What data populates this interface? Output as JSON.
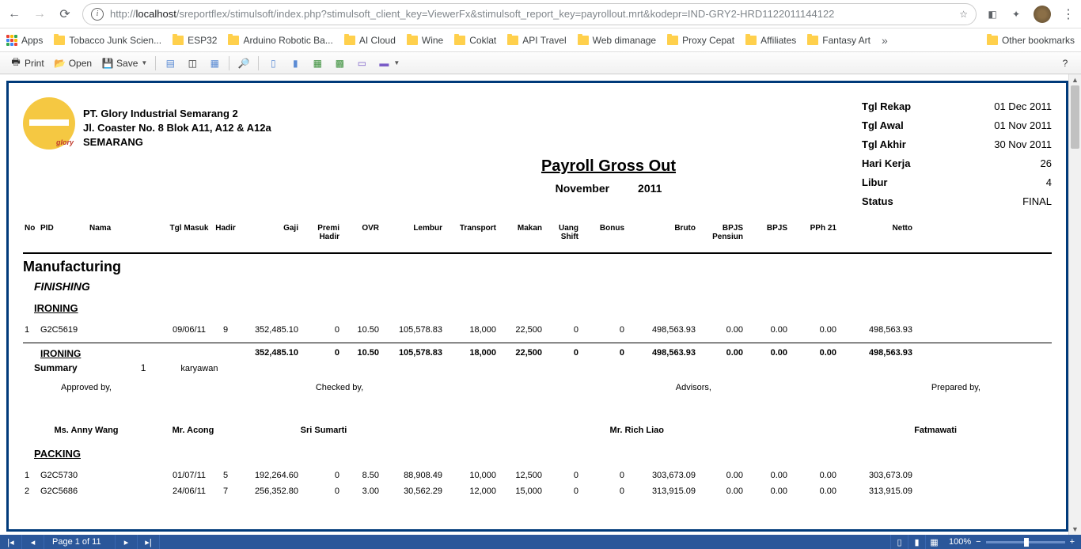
{
  "browser": {
    "url_host": "localhost",
    "url_path": "/sreportflex/stimulsoft/index.php?stimulsoft_client_key=ViewerFx&stimulsoft_report_key=payrollout.mrt&kodepr=IND-GRY2-HRD1122011144122",
    "bookmarks": [
      "Apps",
      "Tobacco Junk Scien...",
      "ESP32",
      "Arduino Robotic Ba...",
      "AI Cloud",
      "Wine",
      "Coklat",
      "API Travel",
      "Web dimanage",
      "Proxy Cepat",
      "Affiliates",
      "Fantasy Art"
    ],
    "other_bookmarks": "Other bookmarks"
  },
  "toolbar": {
    "print": "Print",
    "open": "Open",
    "save": "Save"
  },
  "company": {
    "name": "PT. Glory Industrial Semarang 2",
    "addr": "Jl. Coaster No. 8 Blok A11, A12 & A12a",
    "city": "SEMARANG",
    "logo_text": "glory"
  },
  "report": {
    "title": "Payroll Gross Out",
    "period_month": "November",
    "period_year": "2011"
  },
  "meta": {
    "rows": [
      {
        "lbl": "Tgl Rekap",
        "val": "01 Dec 2011"
      },
      {
        "lbl": "Tgl Awal",
        "val": "01 Nov 2011"
      },
      {
        "lbl": "Tgl Akhir",
        "val": "30 Nov 2011"
      },
      {
        "lbl": "Hari Kerja",
        "val": "26"
      },
      {
        "lbl": "Libur",
        "val": "4"
      },
      {
        "lbl": "Status",
        "val": "FINAL"
      }
    ]
  },
  "columns": {
    "no": "No",
    "pid": "PID",
    "nama": "Nama",
    "tgl": "Tgl Masuk",
    "hadir": "Hadir",
    "gaji": "Gaji",
    "premi": "Premi Hadir",
    "ovr": "OVR",
    "lembur": "Lembur",
    "trans": "Transport",
    "makan": "Makan",
    "uang": "Uang Shift",
    "bonus": "Bonus",
    "bruto": "Bruto",
    "bpjsp": "BPJS Pensiun",
    "bpjs": "BPJS",
    "pph": "PPh 21",
    "netto": "Netto"
  },
  "section": "Manufacturing",
  "subsection": "FINISHING",
  "group1": {
    "name": "IRONING",
    "rows": [
      {
        "no": "1",
        "pid": "G2C5619",
        "nama": "",
        "tgl": "09/06/11",
        "hadir": "9",
        "gaji": "352,485.10",
        "premi": "0",
        "ovr": "10.50",
        "lembur": "105,578.83",
        "trans": "18,000",
        "makan": "22,500",
        "uang": "0",
        "bonus": "0",
        "bruto": "498,563.93",
        "bpjsp": "0.00",
        "bpjs": "0.00",
        "pph": "0.00",
        "netto": "498,563.93"
      }
    ],
    "summary": {
      "gaji": "352,485.10",
      "premi": "0",
      "ovr": "10.50",
      "lembur": "105,578.83",
      "trans": "18,000",
      "makan": "22,500",
      "uang": "0",
      "bonus": "0",
      "bruto": "498,563.93",
      "bpjsp": "0.00",
      "bpjs": "0.00",
      "pph": "0.00",
      "netto": "498,563.93"
    },
    "summary_label": "Summary",
    "count": "1",
    "count_unit": "karyawan"
  },
  "signers": {
    "labels": {
      "approved": "Approved by,",
      "checked": "Checked by,",
      "advisors": "Advisors,",
      "prepared": "Prepared by,"
    },
    "names": {
      "s1": "Ms. Anny Wang",
      "s2": "Mr. Acong",
      "s3": "Sri Sumarti",
      "s4": "Mr. Rich Liao",
      "s5": "Fatmawati"
    }
  },
  "group2": {
    "name": "PACKING",
    "rows": [
      {
        "no": "1",
        "pid": "G2C5730",
        "nama": "",
        "tgl": "01/07/11",
        "hadir": "5",
        "gaji": "192,264.60",
        "premi": "0",
        "ovr": "8.50",
        "lembur": "88,908.49",
        "trans": "10,000",
        "makan": "12,500",
        "uang": "0",
        "bonus": "0",
        "bruto": "303,673.09",
        "bpjsp": "0.00",
        "bpjs": "0.00",
        "pph": "0.00",
        "netto": "303,673.09"
      },
      {
        "no": "2",
        "pid": "G2C5686",
        "nama": "",
        "tgl": "24/06/11",
        "hadir": "7",
        "gaji": "256,352.80",
        "premi": "0",
        "ovr": "3.00",
        "lembur": "30,562.29",
        "trans": "12,000",
        "makan": "15,000",
        "uang": "0",
        "bonus": "0",
        "bruto": "313,915.09",
        "bpjsp": "0.00",
        "bpjs": "0.00",
        "pph": "0.00",
        "netto": "313,915.09"
      }
    ]
  },
  "footer": {
    "page": "Page 1 of 11",
    "zoom": "100%"
  }
}
